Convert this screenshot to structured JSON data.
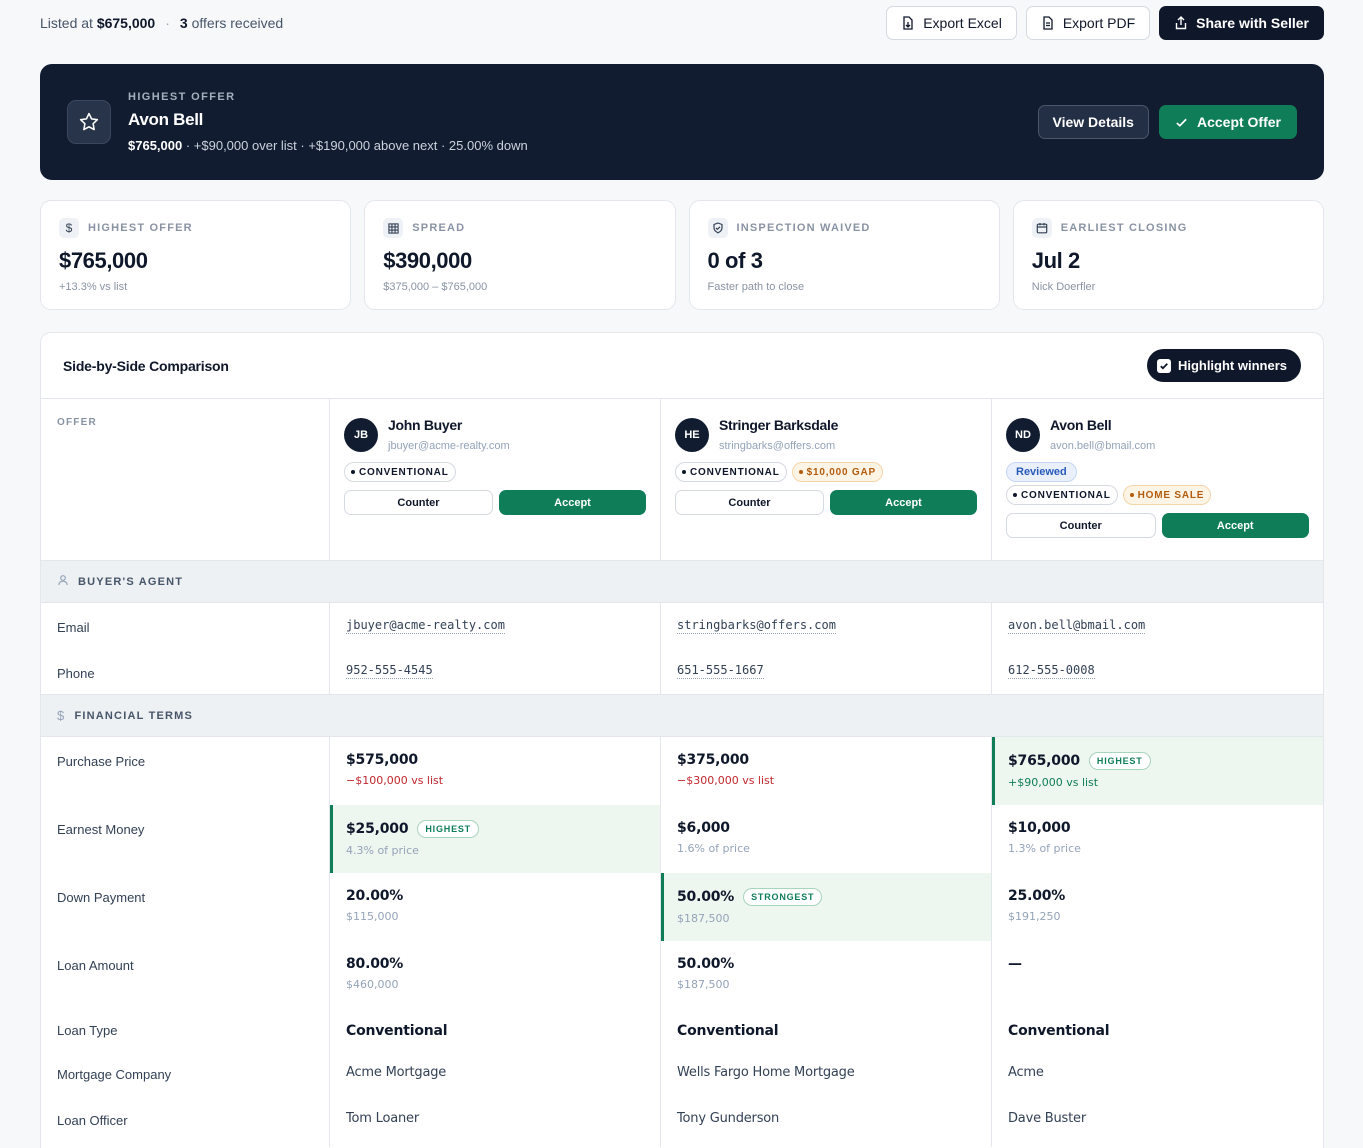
{
  "top": {
    "listed_prefix": "Listed at",
    "list_price": "$675,000",
    "offers_count": "3",
    "offers_suffix": "offers received",
    "actions": {
      "export_excel": "Export Excel",
      "export_pdf": "Export PDF",
      "share": "Share with Seller"
    }
  },
  "hero": {
    "kicker": "HIGHEST OFFER",
    "name": "Avon Bell",
    "price": "$765,000",
    "detail": " · +$90,000 over list · +$190,000 above next · 25.00% down",
    "view_details": "View Details",
    "accept": "Accept Offer"
  },
  "stats": [
    {
      "icon": "dollar-icon",
      "label": "HIGHEST OFFER",
      "value": "$765,000",
      "sub": "+13.3% vs list"
    },
    {
      "icon": "grid-icon",
      "label": "SPREAD",
      "value": "$390,000",
      "sub": "$375,000 – $765,000"
    },
    {
      "icon": "shield-icon",
      "label": "INSPECTION WAIVED",
      "value": "0 of 3",
      "sub": "Faster path to close"
    },
    {
      "icon": "calendar-icon",
      "label": "EARLIEST CLOSING",
      "value": "Jul 2",
      "sub": "Nick Doerfler"
    }
  ],
  "comparison": {
    "title": "Side-by-Side Comparison",
    "highlight_toggle": "Highlight winners",
    "offer_label": "OFFER",
    "buyers": [
      {
        "initials": "JB",
        "name": "John Buyer",
        "email": "jbuyer@acme-realty.com",
        "reviewed": "",
        "chips": [
          "CONVENTIONAL"
        ],
        "warn_chips": []
      },
      {
        "initials": "HE",
        "name": "Stringer Barksdale",
        "email": "stringbarks@offers.com",
        "reviewed": "",
        "chips": [
          "CONVENTIONAL"
        ],
        "warn_chips": [
          "$10,000 GAP"
        ]
      },
      {
        "initials": "ND",
        "name": "Avon Bell",
        "email": "avon.bell@bmail.com",
        "reviewed": "Reviewed",
        "chips": [
          "CONVENTIONAL"
        ],
        "warn_chips": [
          "HOME SALE"
        ]
      }
    ],
    "counter_label": "Counter",
    "accept_label": "Accept",
    "agent_section": "BUYER'S AGENT",
    "agent_rows": [
      {
        "label": "Email",
        "values": [
          "jbuyer@acme-realty.com",
          "stringbarks@offers.com",
          "avon.bell@bmail.com"
        ]
      },
      {
        "label": "Phone",
        "values": [
          "952-555-4545",
          "651-555-1667",
          "612-555-0008"
        ]
      }
    ],
    "financial_section": "FINANCIAL TERMS",
    "financial_rows": [
      {
        "label": "Purchase Price",
        "cells": [
          {
            "main": "$575,000",
            "sub": "−$100,000 vs list",
            "tone": "neg",
            "tag": "",
            "winner": false
          },
          {
            "main": "$375,000",
            "sub": "−$300,000 vs list",
            "tone": "neg",
            "tag": "",
            "winner": false
          },
          {
            "main": "$765,000",
            "sub": "+$90,000 vs list",
            "tone": "pos",
            "tag": "HIGHEST",
            "winner": true
          }
        ]
      },
      {
        "label": "Earnest Money",
        "cells": [
          {
            "main": "$25,000",
            "sub": "4.3% of price",
            "tone": "",
            "tag": "HIGHEST",
            "winner": true
          },
          {
            "main": "$6,000",
            "sub": "1.6% of price",
            "tone": "",
            "tag": "",
            "winner": false
          },
          {
            "main": "$10,000",
            "sub": "1.3% of price",
            "tone": "",
            "tag": "",
            "winner": false
          }
        ]
      },
      {
        "label": "Down Payment",
        "cells": [
          {
            "main": "20.00%",
            "sub": "$115,000",
            "tone": "",
            "tag": "",
            "winner": false
          },
          {
            "main": "50.00%",
            "sub": "$187,500",
            "tone": "",
            "tag": "STRONGEST",
            "winner": true
          },
          {
            "main": "25.00%",
            "sub": "$191,250",
            "tone": "",
            "tag": "",
            "winner": false
          }
        ]
      },
      {
        "label": "Loan Amount",
        "cells": [
          {
            "main": "80.00%",
            "sub": "$460,000",
            "tone": "",
            "tag": "",
            "winner": false
          },
          {
            "main": "50.00%",
            "sub": "$187,500",
            "tone": "",
            "tag": "",
            "winner": false
          },
          {
            "main": "—",
            "sub": "",
            "tone": "",
            "tag": "",
            "winner": false
          }
        ]
      }
    ],
    "loan_rows": [
      {
        "label": "Loan Type",
        "values": [
          "Conventional",
          "Conventional",
          "Conventional"
        ],
        "bold": true
      },
      {
        "label": "Mortgage Company",
        "values": [
          "Acme Mortgage",
          "Wells Fargo Home Mortgage",
          "Acme"
        ],
        "bold": false
      },
      {
        "label": "Loan Officer",
        "values": [
          "Tom Loaner",
          "Tony Gunderson",
          "Dave Buster"
        ],
        "bold": false
      }
    ]
  }
}
